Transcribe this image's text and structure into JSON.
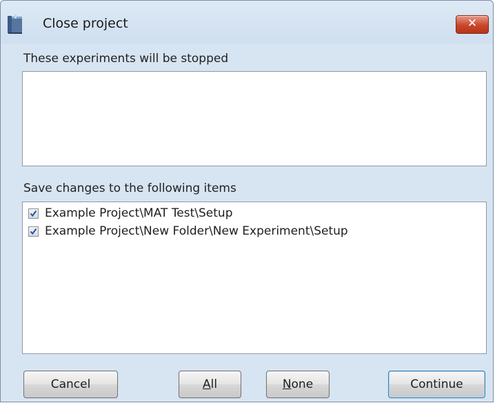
{
  "window": {
    "title": "Close project",
    "close_glyph": "✕",
    "app_icon": "project-book-icon"
  },
  "experiments": {
    "label": "These experiments will be stopped",
    "items": []
  },
  "save": {
    "label": "Save changes to the following items",
    "items": [
      {
        "label": "Example Project\\MAT Test\\Setup",
        "checked": true
      },
      {
        "label": "Example Project\\New Folder\\New Experiment\\Setup",
        "checked": true
      }
    ]
  },
  "buttons": {
    "cancel": "Cancel",
    "all_mnemonic": "A",
    "all_rest": "ll",
    "none_mnemonic": "N",
    "none_rest": "one",
    "continue": "Continue"
  },
  "colors": {
    "dialog_bg": "#d7e4f2",
    "close_red": "#c9452c",
    "check_blue": "#2d4fa0",
    "default_button_border": "#3c7fb1"
  }
}
